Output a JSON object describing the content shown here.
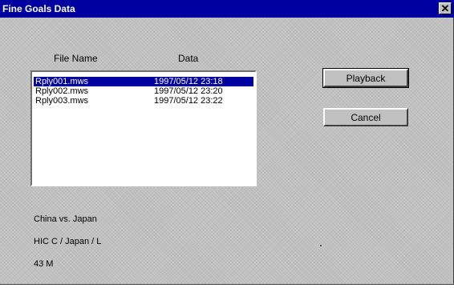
{
  "window": {
    "title": "Fine Goals Data",
    "close_glyph": "✕"
  },
  "list": {
    "headers": {
      "file_name": "File Name",
      "data": "Data"
    },
    "rows": [
      {
        "file": "Rply001.mws",
        "date": "1997/05/12 23:18",
        "selected": true
      },
      {
        "file": "Rply002.mws",
        "date": "1997/05/12 23:20",
        "selected": false
      },
      {
        "file": "Rply003.mws",
        "date": "1997/05/12 23:22",
        "selected": false
      }
    ]
  },
  "buttons": {
    "playback": "Playback",
    "cancel": "Cancel"
  },
  "info": {
    "match": "China  vs.  Japan",
    "teams": "HIC C / Japan / L",
    "time": "43 M"
  },
  "colors": {
    "titlebar": "#0000a0",
    "selection": "#0000a0",
    "face": "#c0c0c0"
  },
  "icons": {
    "close": "close-icon"
  }
}
